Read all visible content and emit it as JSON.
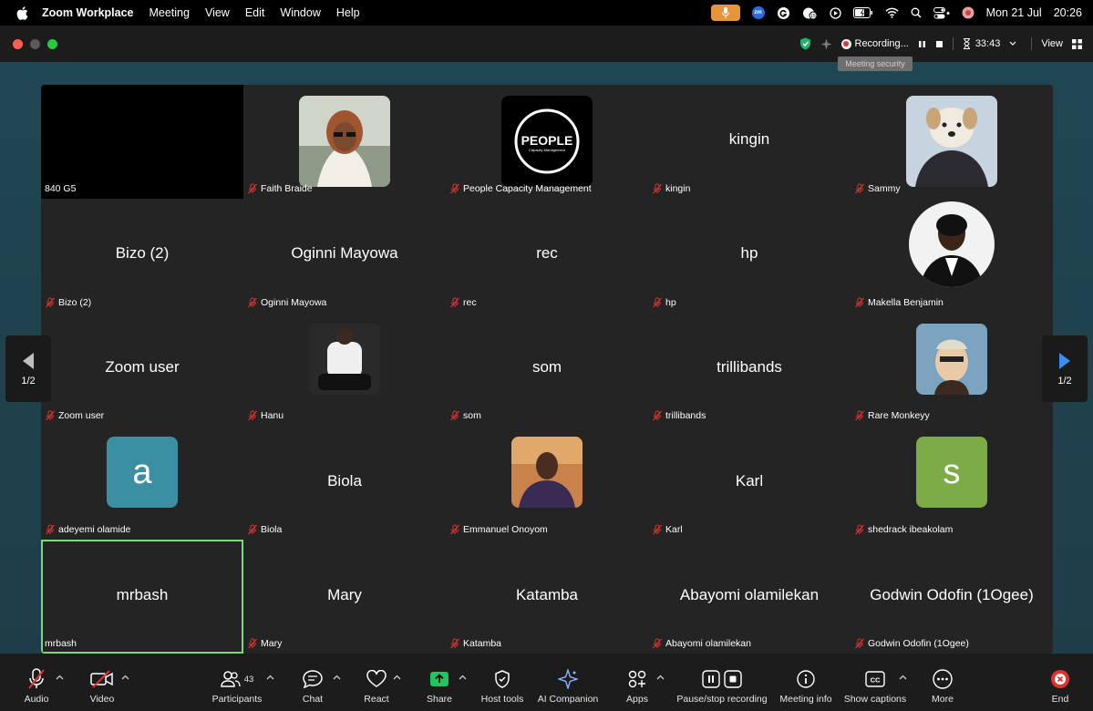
{
  "menubar": {
    "app": "Zoom Workplace",
    "items": [
      "Meeting",
      "View",
      "Edit",
      "Window",
      "Help"
    ],
    "date": "Mon 21 Jul",
    "time": "20:26"
  },
  "titlebar": {
    "recording_label": "Recording...",
    "timer": "33:43",
    "view_label": "View",
    "tooltip": "Meeting security"
  },
  "page_indicator": "1/2",
  "tiles": [
    {
      "label": "840 G5",
      "big": "",
      "style": "black"
    },
    {
      "label": "Faith Braide",
      "big": "",
      "style": "photo-faith"
    },
    {
      "label": "People Capacity Management",
      "big": "",
      "style": "photo-people"
    },
    {
      "label": "kingin",
      "big": "kingin",
      "style": "name"
    },
    {
      "label": "Sammy",
      "big": "",
      "style": "photo-sammy"
    },
    {
      "label": "Bizo (2)",
      "big": "Bizo (2)",
      "style": "name"
    },
    {
      "label": "Oginni Mayowa",
      "big": "Oginni Mayowa",
      "style": "name"
    },
    {
      "label": "rec",
      "big": "rec",
      "style": "name"
    },
    {
      "label": "hp",
      "big": "hp",
      "style": "name"
    },
    {
      "label": "Makella Benjamin",
      "big": "",
      "style": "photo-makella"
    },
    {
      "label": "Zoom user",
      "big": "Zoom user",
      "style": "name"
    },
    {
      "label": "Hanu",
      "big": "",
      "style": "photo-hanu"
    },
    {
      "label": "som",
      "big": "som",
      "style": "name"
    },
    {
      "label": "trillibands",
      "big": "trillibands",
      "style": "name"
    },
    {
      "label": "Rare Monkeyy",
      "big": "",
      "style": "photo-monkey"
    },
    {
      "label": "adeyemi olamide",
      "big": "a",
      "style": "letter-teal"
    },
    {
      "label": "Biola",
      "big": "Biola",
      "style": "name"
    },
    {
      "label": "Emmanuel Onoyom",
      "big": "",
      "style": "photo-emmanuel"
    },
    {
      "label": "Karl",
      "big": "Karl",
      "style": "name"
    },
    {
      "label": "shedrack ibeakolam",
      "big": "s",
      "style": "letter-green"
    },
    {
      "label": "mrbash",
      "big": "mrbash",
      "style": "name-active"
    },
    {
      "label": "Mary",
      "big": "Mary",
      "style": "name"
    },
    {
      "label": "Katamba",
      "big": "Katamba",
      "style": "name"
    },
    {
      "label": "Abayomi olamilekan",
      "big": "Abayomi olamilekan",
      "style": "name"
    },
    {
      "label": "Godwin Odofin (1Ogee)",
      "big": "Godwin Odofin (1Ogee)",
      "style": "name"
    }
  ],
  "toolbar": {
    "audio": "Audio",
    "video": "Video",
    "participants": "Participants",
    "participants_count": "43",
    "chat": "Chat",
    "react": "React",
    "share": "Share",
    "host_tools": "Host tools",
    "ai_companion": "AI Companion",
    "apps": "Apps",
    "pause_stop": "Pause/stop recording",
    "meeting_info": "Meeting info",
    "captions": "Show captions",
    "more": "More",
    "end": "End"
  },
  "colors": {
    "accent_green": "#7ed87a",
    "share_green": "#22c55e",
    "end_red": "#e0332e",
    "mute_red": "#e0332e",
    "teal_avatar": "#3a8fa3",
    "green_avatar": "#7cab48"
  }
}
